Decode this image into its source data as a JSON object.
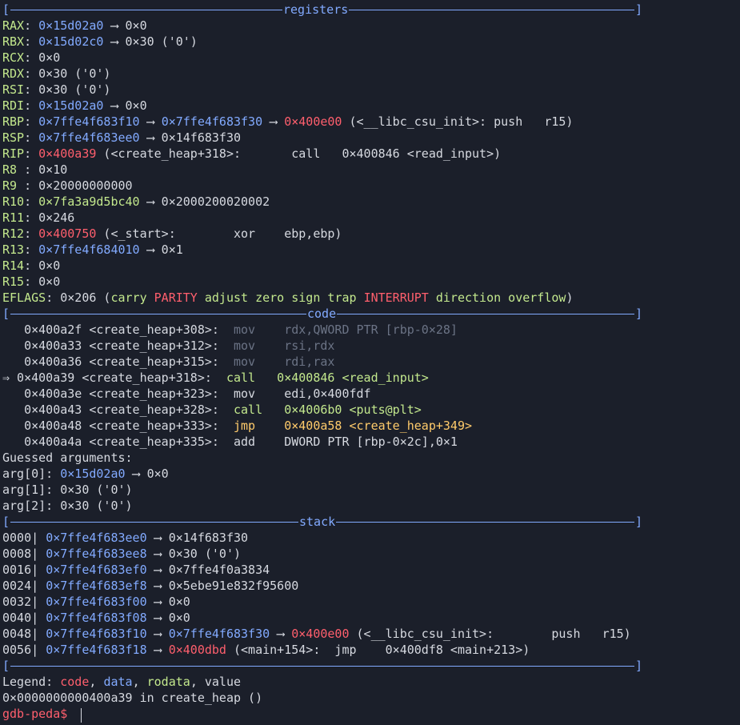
{
  "sections": {
    "registers": "registers",
    "code": "code",
    "stack": "stack"
  },
  "registers": [
    {
      "name": "RAX",
      "segs": [
        {
          "t": "RAX",
          "c": "grn"
        },
        {
          "t": ": "
        },
        {
          "t": "0×15d02a0",
          "c": "blu"
        },
        {
          "t": " ⟶ 0×0"
        }
      ]
    },
    {
      "name": "RBX",
      "segs": [
        {
          "t": "RBX",
          "c": "grn"
        },
        {
          "t": ": "
        },
        {
          "t": "0×15d02c0",
          "c": "blu"
        },
        {
          "t": " ⟶ 0×30 ('0')"
        }
      ]
    },
    {
      "name": "RCX",
      "segs": [
        {
          "t": "RCX",
          "c": "grn"
        },
        {
          "t": ": 0×0"
        }
      ]
    },
    {
      "name": "RDX",
      "segs": [
        {
          "t": "RDX",
          "c": "grn"
        },
        {
          "t": ": 0×30 ('0')"
        }
      ]
    },
    {
      "name": "RSI",
      "segs": [
        {
          "t": "RSI",
          "c": "grn"
        },
        {
          "t": ": 0×30 ('0')"
        }
      ]
    },
    {
      "name": "RDI",
      "segs": [
        {
          "t": "RDI",
          "c": "grn"
        },
        {
          "t": ": "
        },
        {
          "t": "0×15d02a0",
          "c": "blu"
        },
        {
          "t": " ⟶ 0×0"
        }
      ]
    },
    {
      "name": "RBP",
      "segs": [
        {
          "t": "RBP",
          "c": "grn"
        },
        {
          "t": ": "
        },
        {
          "t": "0×7ffe4f683f10",
          "c": "blu"
        },
        {
          "t": " ⟶ "
        },
        {
          "t": "0×7ffe4f683f30",
          "c": "blu"
        },
        {
          "t": " ⟶ "
        },
        {
          "t": "0×400e00",
          "c": "red"
        },
        {
          "t": " (<__libc_csu_init>: push   r15)"
        }
      ]
    },
    {
      "name": "RSP",
      "segs": [
        {
          "t": "RSP",
          "c": "grn"
        },
        {
          "t": ": "
        },
        {
          "t": "0×7ffe4f683ee0",
          "c": "blu"
        },
        {
          "t": " ⟶ 0×14f683f30"
        }
      ]
    },
    {
      "name": "RIP",
      "segs": [
        {
          "t": "RIP",
          "c": "grn"
        },
        {
          "t": ": "
        },
        {
          "t": "0×400a39",
          "c": "red"
        },
        {
          "t": " (<create_heap+318>:       call   0×400846 <read_input>)"
        }
      ]
    },
    {
      "name": "R8",
      "segs": [
        {
          "t": "R8 ",
          "c": "grn"
        },
        {
          "t": ": 0×10"
        }
      ]
    },
    {
      "name": "R9",
      "segs": [
        {
          "t": "R9 ",
          "c": "grn"
        },
        {
          "t": ": 0×20000000000"
        }
      ]
    },
    {
      "name": "R10",
      "segs": [
        {
          "t": "R10",
          "c": "grn"
        },
        {
          "t": ": "
        },
        {
          "t": "0×7fa3a9d5bc40",
          "c": "grn"
        },
        {
          "t": " ⟶ 0×2000200020002"
        }
      ]
    },
    {
      "name": "R11",
      "segs": [
        {
          "t": "R11",
          "c": "grn"
        },
        {
          "t": ": 0×246"
        }
      ]
    },
    {
      "name": "R12",
      "segs": [
        {
          "t": "R12",
          "c": "grn"
        },
        {
          "t": ": "
        },
        {
          "t": "0×400750",
          "c": "red"
        },
        {
          "t": " (<_start>:        xor    ebp,ebp)"
        }
      ]
    },
    {
      "name": "R13",
      "segs": [
        {
          "t": "R13",
          "c": "grn"
        },
        {
          "t": ": "
        },
        {
          "t": "0×7ffe4f684010",
          "c": "blu"
        },
        {
          "t": " ⟶ 0×1"
        }
      ]
    },
    {
      "name": "R14",
      "segs": [
        {
          "t": "R14",
          "c": "grn"
        },
        {
          "t": ": 0×0"
        }
      ]
    },
    {
      "name": "R15",
      "segs": [
        {
          "t": "R15",
          "c": "grn"
        },
        {
          "t": ": 0×0"
        }
      ]
    },
    {
      "name": "EFLAGS",
      "segs": [
        {
          "t": "EFLAGS",
          "c": "grn"
        },
        {
          "t": ": 0×206 ("
        },
        {
          "t": "carry ",
          "c": "grn"
        },
        {
          "t": "PARITY",
          "c": "red"
        },
        {
          "t": " adjust zero sign trap ",
          "c": "grn"
        },
        {
          "t": "INTERRUPT",
          "c": "red"
        },
        {
          "t": " direction overflow",
          "c": "grn"
        },
        {
          "t": ")"
        }
      ]
    }
  ],
  "code": [
    {
      "segs": [
        {
          "t": "   0×400a2f <create_heap+308>:  "
        },
        {
          "t": "mov    rdx,QWORD PTR [rbp-0×28]",
          "c": "dim"
        }
      ]
    },
    {
      "segs": [
        {
          "t": "   0×400a33 <create_heap+312>:  "
        },
        {
          "t": "mov    rsi,rdx",
          "c": "dim"
        }
      ]
    },
    {
      "segs": [
        {
          "t": "   0×400a36 <create_heap+315>:  "
        },
        {
          "t": "mov    rdi,rax",
          "c": "dim"
        }
      ]
    },
    {
      "segs": [
        {
          "t": "⇒ 0×400a39 <create_heap+318>:  "
        },
        {
          "t": "call   0×400846 <read_input>",
          "c": "grn"
        }
      ]
    },
    {
      "segs": [
        {
          "t": "   0×400a3e <create_heap+323>:  mov    edi,0×400fdf"
        }
      ]
    },
    {
      "segs": [
        {
          "t": "   0×400a43 <create_heap+328>:  "
        },
        {
          "t": "call   0×4006b0 <puts@plt>",
          "c": "grn"
        }
      ]
    },
    {
      "segs": [
        {
          "t": "   0×400a48 <create_heap+333>:  "
        },
        {
          "t": "jmp    0×400a58 <create_heap+349>",
          "c": "yel"
        }
      ]
    },
    {
      "segs": [
        {
          "t": "   0×400a4a <create_heap+335>:  add    DWORD PTR [rbp-0×2c],0×1"
        }
      ]
    }
  ],
  "guessed": {
    "header": "Guessed arguments:",
    "args": [
      {
        "segs": [
          {
            "t": "arg[0]: "
          },
          {
            "t": "0×15d02a0",
            "c": "blu"
          },
          {
            "t": " ⟶ 0×0"
          }
        ]
      },
      {
        "segs": [
          {
            "t": "arg[1]: 0×30 ('0')"
          }
        ]
      },
      {
        "segs": [
          {
            "t": "arg[2]: 0×30 ('0')"
          }
        ]
      }
    ]
  },
  "stack": [
    {
      "segs": [
        {
          "t": "0000| "
        },
        {
          "t": "0×7ffe4f683ee0",
          "c": "blu"
        },
        {
          "t": " ⟶ 0×14f683f30"
        }
      ]
    },
    {
      "segs": [
        {
          "t": "0008| "
        },
        {
          "t": "0×7ffe4f683ee8",
          "c": "blu"
        },
        {
          "t": " ⟶ 0×30 ('0')"
        }
      ]
    },
    {
      "segs": [
        {
          "t": "0016| "
        },
        {
          "t": "0×7ffe4f683ef0",
          "c": "blu"
        },
        {
          "t": " ⟶ 0×7ffe4f0a3834"
        }
      ]
    },
    {
      "segs": [
        {
          "t": "0024| "
        },
        {
          "t": "0×7ffe4f683ef8",
          "c": "blu"
        },
        {
          "t": " ⟶ 0×5ebe91e832f95600"
        }
      ]
    },
    {
      "segs": [
        {
          "t": "0032| "
        },
        {
          "t": "0×7ffe4f683f00",
          "c": "blu"
        },
        {
          "t": " ⟶ 0×0"
        }
      ]
    },
    {
      "segs": [
        {
          "t": "0040| "
        },
        {
          "t": "0×7ffe4f683f08",
          "c": "blu"
        },
        {
          "t": " ⟶ 0×0"
        }
      ]
    },
    {
      "segs": [
        {
          "t": "0048| "
        },
        {
          "t": "0×7ffe4f683f10",
          "c": "blu"
        },
        {
          "t": " ⟶ "
        },
        {
          "t": "0×7ffe4f683f30",
          "c": "blu"
        },
        {
          "t": " ⟶ "
        },
        {
          "t": "0×400e00",
          "c": "red"
        },
        {
          "t": " (<__libc_csu_init>:        push   r15)"
        }
      ]
    },
    {
      "segs": [
        {
          "t": "0056| "
        },
        {
          "t": "0×7ffe4f683f18",
          "c": "blu"
        },
        {
          "t": " ⟶ "
        },
        {
          "t": "0×400dbd",
          "c": "red"
        },
        {
          "t": " (<main+154>:  jmp    0×400df8 <main+213>)"
        }
      ]
    }
  ],
  "legend": {
    "segs": [
      {
        "t": "Legend: "
      },
      {
        "t": "code",
        "c": "red"
      },
      {
        "t": ", "
      },
      {
        "t": "data",
        "c": "blu"
      },
      {
        "t": ", "
      },
      {
        "t": "rodata",
        "c": "grn"
      },
      {
        "t": ", value"
      }
    ]
  },
  "location": "0×0000000000400a39 in create_heap ()",
  "prompt": "gdb-peda$ ",
  "colors": {
    "background": "#1b1f2a",
    "separator": "#82aaff",
    "register": "#c3e88d",
    "data": "#82aaff",
    "code": "#ff5f6d",
    "jump": "#ffcb6b"
  }
}
